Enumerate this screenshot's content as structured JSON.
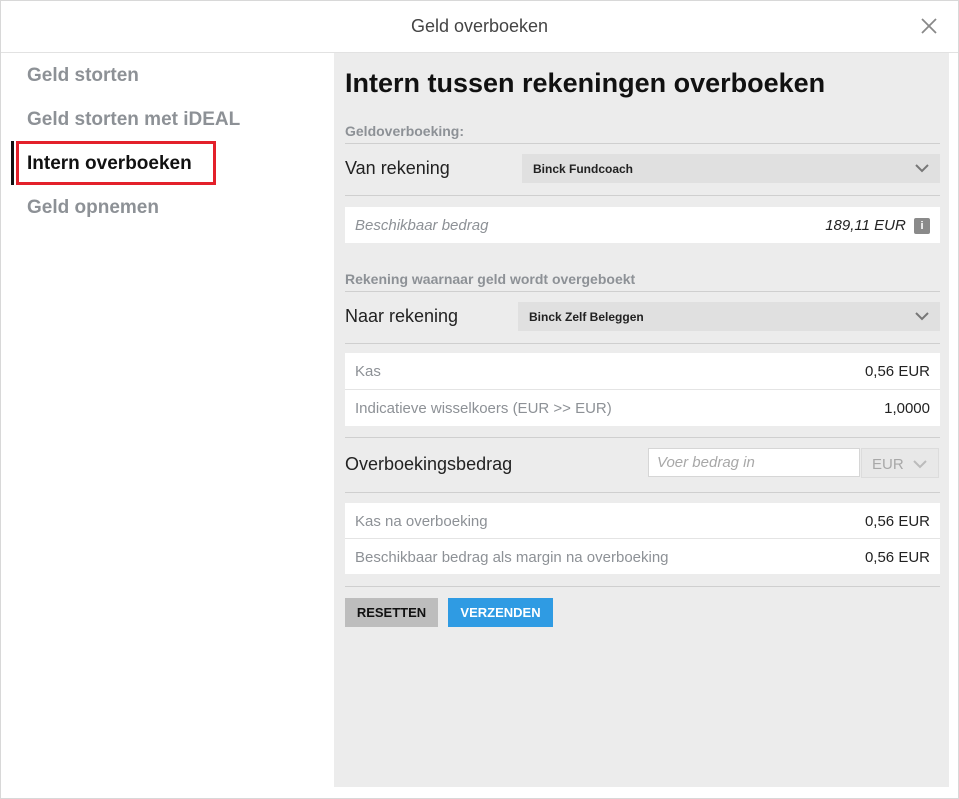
{
  "dialog": {
    "title": "Geld overboeken"
  },
  "sidebar": {
    "items": [
      {
        "label": "Geld storten"
      },
      {
        "label": "Geld storten met iDEAL"
      },
      {
        "label": "Intern overboeken"
      },
      {
        "label": "Geld opnemen"
      }
    ],
    "active_index": 2
  },
  "main": {
    "heading": "Intern tussen rekeningen overboeken",
    "section_from": "Geldoverboeking:",
    "from_label": "Van rekening",
    "from_account": "Binck Fundcoach",
    "available_label": "Beschikbaar bedrag",
    "available_value": "189,11 EUR",
    "info_icon_glyph": "i",
    "section_to": "Rekening waarnaar geld wordt overgeboekt",
    "to_label": "Naar rekening",
    "to_account": "Binck Zelf Beleggen",
    "to_details": [
      {
        "label": "Kas",
        "value": "0,56 EUR"
      },
      {
        "label": "Indicatieve wisselkoers (EUR >> EUR)",
        "value": "1,0000"
      }
    ],
    "amount_label": "Overboekingsbedrag",
    "amount_value": "",
    "amount_placeholder": "Voer bedrag in",
    "currency": "EUR",
    "after_details": [
      {
        "label": "Kas na overboeking",
        "value": "0,56 EUR"
      },
      {
        "label": "Beschikbaar bedrag als margin na overboeking",
        "value": "0,56 EUR"
      }
    ],
    "reset_label": "RESETTEN",
    "send_label": "VERZENDEN"
  },
  "colors": {
    "accent": "#2f9be3",
    "highlight": "#e3202a",
    "panel_bg": "#ececec",
    "muted_text": "#8d9196"
  }
}
